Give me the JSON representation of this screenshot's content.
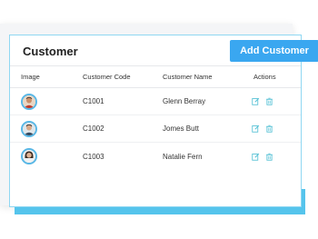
{
  "header": {
    "title": "Customer",
    "add_button_label": "Add Customer"
  },
  "table": {
    "columns": [
      "Image",
      "Customer Code",
      "Customer Name",
      "Actions"
    ],
    "rows": [
      {
        "code": "C1001",
        "name": "Glenn Berray"
      },
      {
        "code": "C1002",
        "name": "Jomes Butt"
      },
      {
        "code": "C1003",
        "name": "Natalie Fern"
      }
    ]
  },
  "icons": {
    "edit": "edit-icon",
    "delete": "trash-icon",
    "avatar": "avatar-photo"
  },
  "colors": {
    "accent": "#3aa7f0",
    "accent_bar": "#55c4ec",
    "action_icon": "#5bc3d6"
  }
}
